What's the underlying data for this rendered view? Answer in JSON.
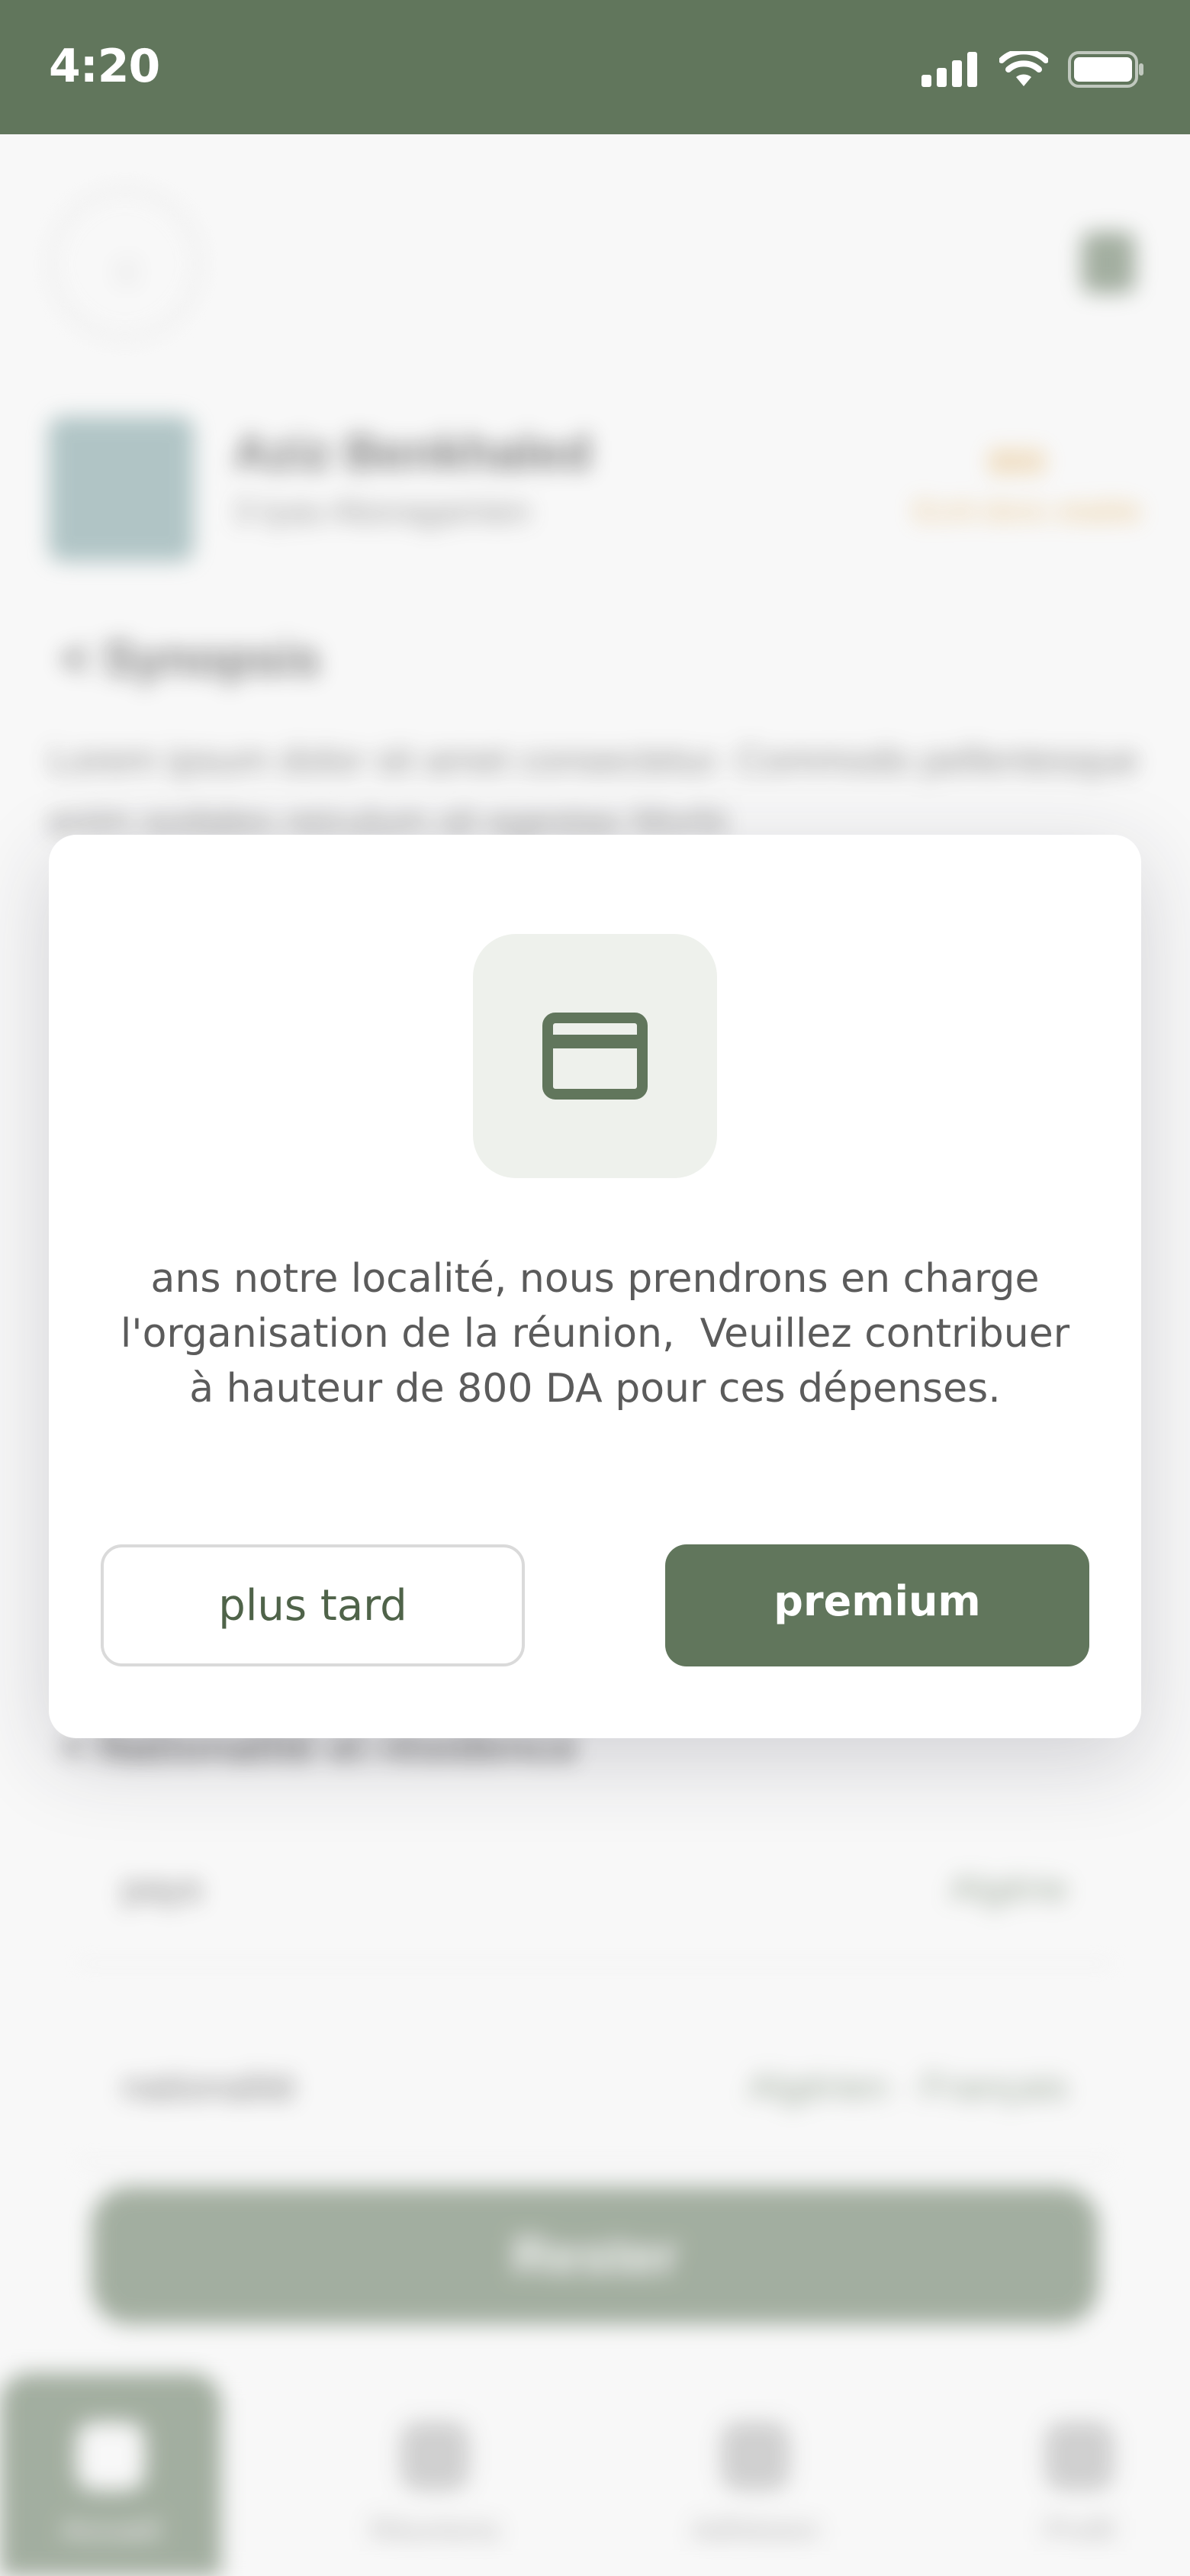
{
  "status_bar": {
    "time": "4:20"
  },
  "background": {
    "user_name": "Aziz Benkhaled",
    "user_subtitle": "3 tyas Aboragamien",
    "price": "800",
    "price_subtitle": "Ecrit donc etable",
    "section_title": "< Synopsis",
    "lorem": "Lorem ipsum dolor sit amet consectetur. Commodo pellentesque enim sodales reiculum sit egestas Morbi",
    "section_title_2": "< Nationalité et résidence",
    "rows": [
      {
        "key": "pays",
        "value": "Algérie"
      },
      {
        "key": "nationalité",
        "value": "Algérien · Français"
      }
    ],
    "submit_label": "Rester",
    "tabs": [
      "Accueil",
      "Réunions",
      "Adhésion",
      "Profil"
    ]
  },
  "modal": {
    "icon": "credit-card-icon",
    "message_lines": [
      "ans notre localité, nous prendrons en charge",
      "l'organisation de la réunion,  Veuillez contribuer",
      "à hauteur de 800 DA pour ces dépenses."
    ],
    "later_label": "plus tard",
    "premium_label": "premium"
  },
  "colors": {
    "accent": "#61765c",
    "icon_box": "#eef1ec",
    "text_muted": "#5b5b5b"
  }
}
